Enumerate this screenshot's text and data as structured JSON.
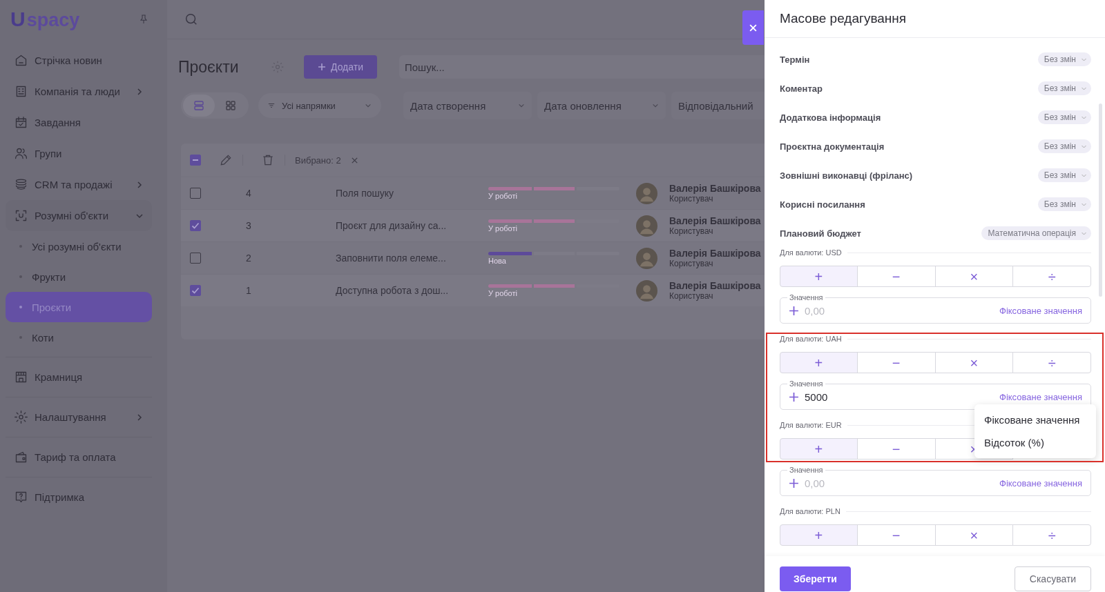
{
  "sidebar": {
    "logo": {
      "mark": "U",
      "text": "spacy"
    },
    "groups": [
      [
        {
          "label": "Стрічка новин",
          "selected": false
        },
        {
          "label": "Компанія та люди",
          "selected": false,
          "expanded": false
        },
        {
          "label": "Завдання",
          "selected": false
        },
        {
          "label": "Групи",
          "selected": false
        },
        {
          "label": "CRM та продажі",
          "selected": false,
          "expanded": false
        },
        {
          "label": "Розумні об'єкти",
          "selected": false,
          "expanded": true,
          "children": [
            {
              "label": "Усі розумні об'єкти",
              "selected": false
            },
            {
              "label": "Фрукти",
              "selected": false
            },
            {
              "label": "Проєкти",
              "selected": true
            },
            {
              "label": "Коти",
              "selected": false
            }
          ]
        }
      ],
      [
        {
          "label": "Крамниця",
          "selected": false
        }
      ],
      [
        {
          "label": "Налаштування",
          "selected": false,
          "expanded": false
        }
      ],
      [
        {
          "label": "Тариф та оплата",
          "selected": false
        }
      ],
      [
        {
          "label": "Підтримка",
          "selected": false
        }
      ]
    ]
  },
  "page": {
    "title": "Проєкти",
    "add_button": "Додати",
    "search": {
      "placeholder": "Пошук..."
    },
    "view_toggle": [
      {
        "selected": true
      },
      {
        "selected": false
      }
    ],
    "direction_filter": "Усі напрямки",
    "filters": [
      "Дата створення",
      "Дата оновлення",
      "Відповідальний"
    ]
  },
  "table": {
    "select_all_indeterminate": true,
    "selection_count": "Вибрано: 2",
    "rows": [
      {
        "checked": false,
        "id": "4",
        "name": "Поля пошуку",
        "status": "У роботі",
        "level": 0.67,
        "color": "#a87499",
        "user": "Валерія Башкірова",
        "role": "Користувач"
      },
      {
        "checked": true,
        "id": "3",
        "name": "Проєкт для дизайну са...",
        "status": "У роботі",
        "level": 0.67,
        "color": "#a87499",
        "user": "Валерія Башкірова",
        "role": "Користувач"
      },
      {
        "checked": false,
        "id": "2",
        "name": "Заповнити поля елеме...",
        "status": "Нова",
        "level": 0.33,
        "color": "#5d4a9a",
        "user": "Валерія Башкірова",
        "role": "Користувач"
      },
      {
        "checked": true,
        "id": "1",
        "name": "Доступна робота з дош...",
        "status": "У роботі",
        "level": 0.67,
        "color": "#a87499",
        "user": "Валерія Башкірова",
        "role": "Користувач"
      }
    ]
  },
  "panel": {
    "title": "Масове редагування",
    "fields": [
      {
        "label": "Термін",
        "value": "Без змін"
      },
      {
        "label": "Коментар",
        "value": "Без змін"
      },
      {
        "label": "Додаткова інформація",
        "value": "Без змін"
      },
      {
        "label": "Проєктна документація",
        "value": "Без змін"
      },
      {
        "label": "Зовнішні виконавці (фріланс)",
        "value": "Без змін"
      },
      {
        "label": "Корисні посилання",
        "value": "Без змін"
      },
      {
        "label": "Плановий бюджет",
        "value": "Математична операція"
      }
    ],
    "currencies": [
      {
        "label": "Для валюти: USD",
        "operations": [
          {
            "symbol": "+",
            "selected": true
          },
          {
            "symbol": "−",
            "selected": false
          },
          {
            "symbol": "×",
            "selected": false
          },
          {
            "symbol": "÷",
            "selected": false
          }
        ],
        "value_field": {
          "label": "Значення",
          "placeholder": "0,00",
          "mode": "Фіксоване значення"
        }
      },
      {
        "label": "Для валюти: UAH",
        "operations": [
          {
            "symbol": "+",
            "selected": true
          },
          {
            "symbol": "−",
            "selected": false
          },
          {
            "symbol": "×",
            "selected": false
          },
          {
            "symbol": "÷",
            "selected": false
          }
        ],
        "value_field": {
          "label": "Значення",
          "value": "5000",
          "mode": "Фіксоване значення",
          "menu": [
            "Фіксоване значення",
            "Відсоток (%)"
          ]
        }
      },
      {
        "label": "Для валюти: EUR",
        "operations": [
          {
            "symbol": "+",
            "selected": true
          },
          {
            "symbol": "−",
            "selected": false
          },
          {
            "symbol": "×",
            "selected": false
          }
        ],
        "value_field": {
          "label": "Значення",
          "placeholder": "0,00",
          "mode": "Фіксоване значення"
        }
      },
      {
        "label": "Для валюти: PLN",
        "operations": [
          {
            "symbol": "+",
            "selected": true
          },
          {
            "symbol": "−",
            "selected": false
          },
          {
            "symbol": "×",
            "selected": false
          },
          {
            "symbol": "÷",
            "selected": false
          }
        ]
      }
    ],
    "save": "Зберегти",
    "cancel": "Скасувати"
  }
}
